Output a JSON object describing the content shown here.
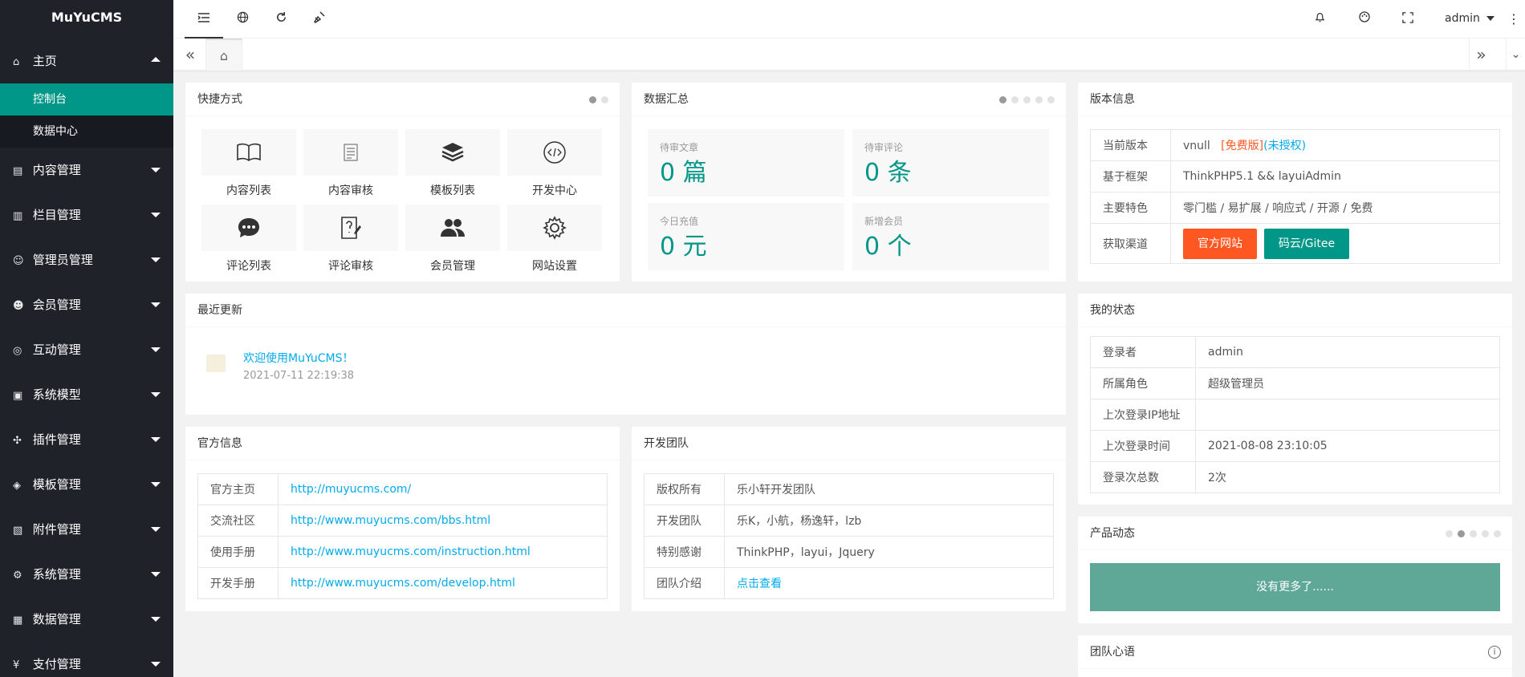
{
  "app": {
    "logo": "MuYuCMS"
  },
  "sidebar": {
    "items": [
      {
        "icon": "home-icon",
        "label": "主页",
        "expanded": true
      },
      {
        "icon": "content-icon",
        "label": "内容管理"
      },
      {
        "icon": "column-icon",
        "label": "栏目管理"
      },
      {
        "icon": "admin-icon",
        "label": "管理员管理"
      },
      {
        "icon": "member-icon",
        "label": "会员管理"
      },
      {
        "icon": "interact-icon",
        "label": "互动管理"
      },
      {
        "icon": "model-icon",
        "label": "系统模型"
      },
      {
        "icon": "plugin-icon",
        "label": "插件管理"
      },
      {
        "icon": "template-icon",
        "label": "模板管理"
      },
      {
        "icon": "attachment-icon",
        "label": "附件管理"
      },
      {
        "icon": "system-icon",
        "label": "系统管理"
      },
      {
        "icon": "data-icon",
        "label": "数据管理"
      },
      {
        "icon": "pay-icon",
        "label": "支付管理"
      }
    ],
    "subitems": [
      {
        "label": "控制台",
        "active": true
      },
      {
        "label": "数据中心",
        "active": false
      }
    ]
  },
  "header": {
    "user": "admin"
  },
  "shortcuts": {
    "title": "快捷方式",
    "items": [
      {
        "icon": "book-icon",
        "label": "内容列表"
      },
      {
        "icon": "document-icon",
        "label": "内容审核"
      },
      {
        "icon": "layers-icon",
        "label": "模板列表"
      },
      {
        "icon": "code-icon",
        "label": "开发中心"
      },
      {
        "icon": "chat-icon",
        "label": "评论列表"
      },
      {
        "icon": "review-icon",
        "label": "评论审核"
      },
      {
        "icon": "users-icon",
        "label": "会员管理"
      },
      {
        "icon": "gear-icon",
        "label": "网站设置"
      }
    ]
  },
  "stats": {
    "title": "数据汇总",
    "items": [
      {
        "label": "待审文章",
        "value": "0 篇"
      },
      {
        "label": "待审评论",
        "value": "0 条"
      },
      {
        "label": "今日充值",
        "value": "0 元"
      },
      {
        "label": "新增会员",
        "value": "0 个"
      }
    ]
  },
  "version": {
    "title": "版本信息",
    "rows": [
      {
        "k": "当前版本",
        "v": "vnull"
      },
      {
        "k": "基于框架",
        "v": "ThinkPHP5.1 && layuiAdmin"
      },
      {
        "k": "主要特色",
        "v": "零门槛 / 易扩展 / 响应式 / 开源 / 免费"
      },
      {
        "k": "获取渠道",
        "v": ""
      }
    ],
    "free_tag": "[免费版]",
    "auth_tag": "(未授权)",
    "btn_official": "官方网站",
    "btn_gitee": "码云/Gitee"
  },
  "recent": {
    "title": "最近更新",
    "item_title": "欢迎使用MuYuCMS！",
    "item_time": "2021-07-11 22:19:38"
  },
  "status": {
    "title": "我的状态",
    "rows": [
      {
        "k": "登录者",
        "v": "admin"
      },
      {
        "k": "所属角色",
        "v": "超级管理员"
      },
      {
        "k": "上次登录IP地址",
        "v": ""
      },
      {
        "k": "上次登录时间",
        "v": "2021-08-08 23:10:05"
      },
      {
        "k": "登录次总数",
        "v": "2次"
      }
    ]
  },
  "official": {
    "title": "官方信息",
    "rows": [
      {
        "k": "官方主页",
        "v": "http://muyucms.com/"
      },
      {
        "k": "交流社区",
        "v": "http://www.muyucms.com/bbs.html"
      },
      {
        "k": "使用手册",
        "v": "http://www.muyucms.com/instruction.html"
      },
      {
        "k": "开发手册",
        "v": "http://www.muyucms.com/develop.html"
      }
    ]
  },
  "team": {
    "title": "开发团队",
    "rows": [
      {
        "k": "版权所有",
        "v": "乐小轩开发团队"
      },
      {
        "k": "开发团队",
        "v": "乐K，小航，杨逸轩，lzb"
      },
      {
        "k": "特别感谢",
        "v": "ThinkPHP，layui，Jquery"
      },
      {
        "k": "团队介绍",
        "v": "点击查看"
      }
    ]
  },
  "product": {
    "title": "产品动态",
    "empty": "没有更多了......"
  },
  "motto": {
    "title": "团队心语"
  },
  "colors": {
    "accent": "#009688",
    "sidebar": "#20222a",
    "orange": "#FF5722",
    "link": "#01AAED"
  }
}
